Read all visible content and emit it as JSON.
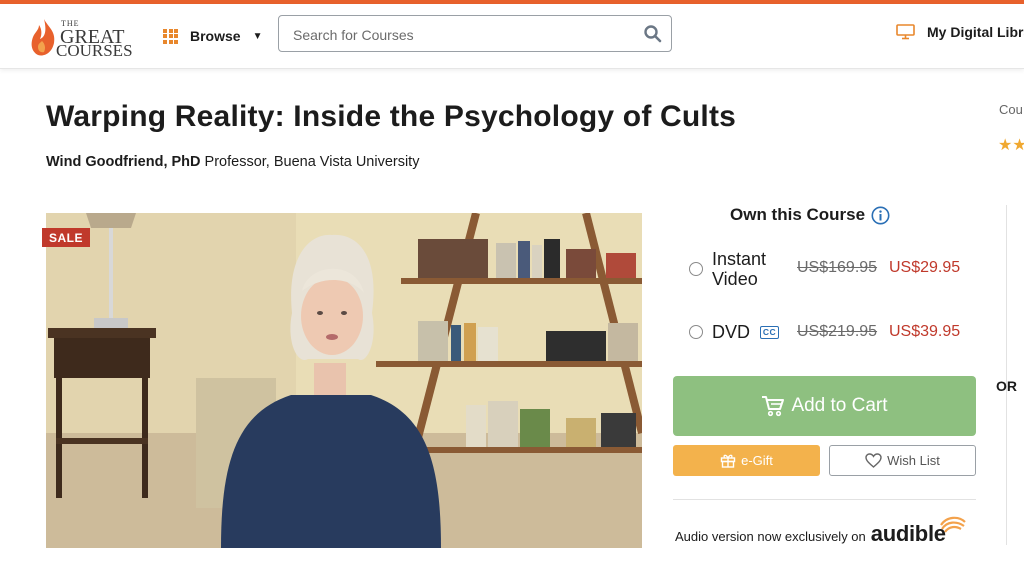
{
  "header": {
    "logo": {
      "the": "THE",
      "great": "GREAT",
      "courses": "COURSES"
    },
    "browse_label": "Browse",
    "search_placeholder": "Search for Courses",
    "library_label": "My Digital Library"
  },
  "course": {
    "title": "Warping Reality: Inside the Psychology of Cults",
    "professor_name": "Wind Goodfriend, PhD",
    "professor_affiliation": "Professor, Buena Vista University"
  },
  "promo": {
    "sale_badge": "SALE"
  },
  "purchase": {
    "heading": "Own this Course",
    "options": [
      {
        "label_line1": "Instant",
        "label_line2": "Video",
        "old_price": "US$169.95",
        "new_price": "US$29.95"
      },
      {
        "label": "DVD",
        "badge": "CC",
        "old_price": "US$219.95",
        "new_price": "US$39.95"
      }
    ],
    "add_to_cart": "Add to Cart",
    "egift": "e-Gift",
    "wishlist": "Wish List",
    "audio_note": "Audio version now exclusively on",
    "audio_brand": "audible"
  },
  "side": {
    "cou": "Cou",
    "or": "OR",
    "stars": "★★"
  },
  "colors": {
    "accent": "#e8612c",
    "sale": "#c0392b",
    "cart": "#8ec080",
    "egift": "#f3b24c",
    "price": "#c0392b"
  },
  "icons": [
    "flame-logo-icon",
    "grid-icon",
    "chevron-down-icon",
    "search-icon",
    "monitor-icon",
    "info-icon",
    "cc-icon",
    "cart-icon",
    "gift-icon",
    "heart-icon",
    "audible-wave-icon"
  ]
}
